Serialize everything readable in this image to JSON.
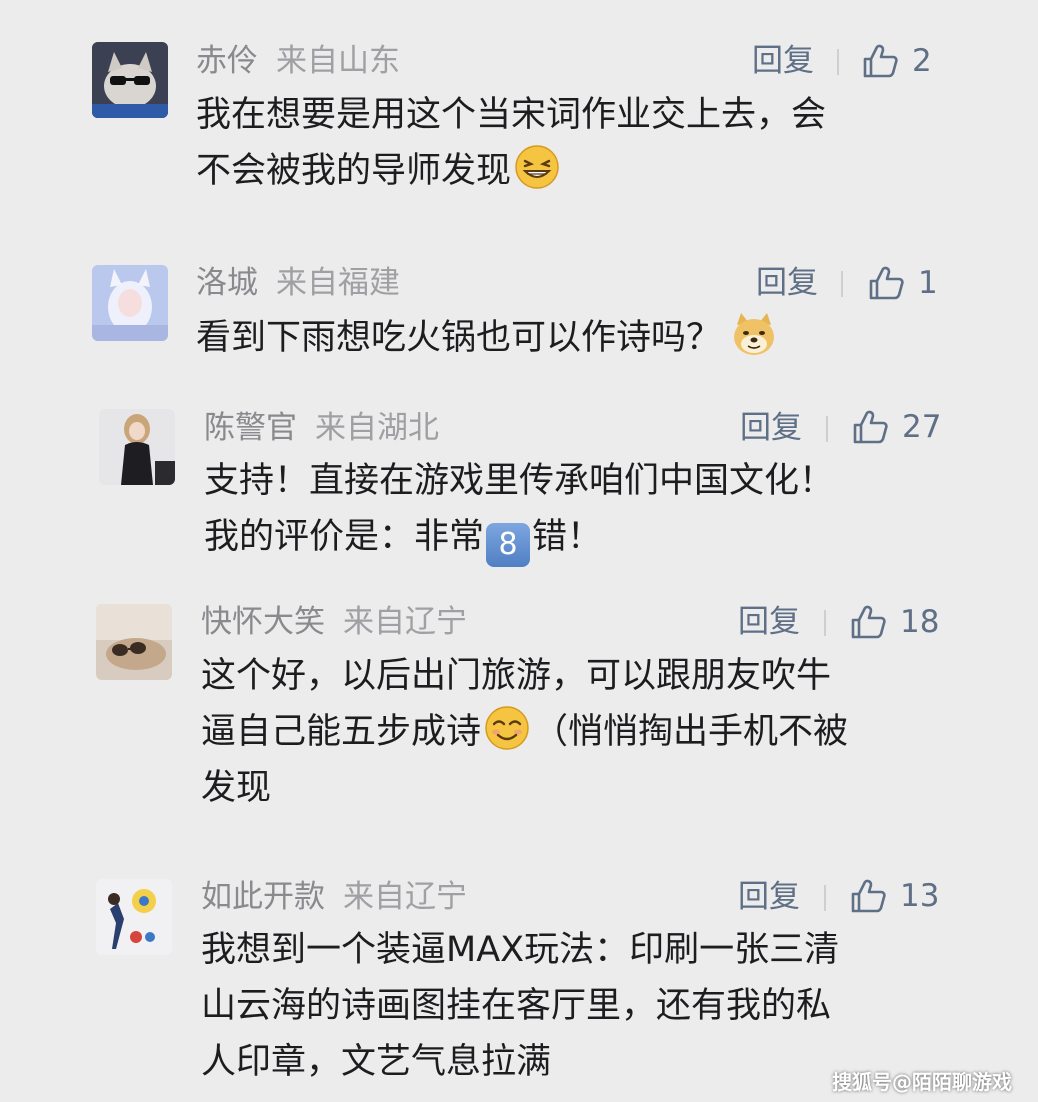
{
  "reply_label": "回复",
  "comments": [
    {
      "username": "赤伶",
      "location": "来自山东",
      "likes": "2",
      "lines": [
        "我在想要是用这个当宋词作业交上去，会",
        "不会被我的导师发现"
      ]
    },
    {
      "username": "洛城",
      "location": "来自福建",
      "likes": "1",
      "lines": [
        "看到下雨想吃火锅也可以作诗吗？"
      ]
    },
    {
      "username": "陈警官",
      "location": "来自湖北",
      "likes": "27",
      "lines": [
        "支持！直接在游戏里传承咱们中国文化！",
        "我的评价是：非常",
        "错！"
      ],
      "badge": "8"
    },
    {
      "username": "快怀大笑",
      "location": "来自辽宁",
      "likes": "18",
      "lines": [
        "这个好，以后出门旅游，可以跟朋友吹牛",
        "逼自己能五步成诗",
        "（悄悄掏出手机不被",
        "发现"
      ]
    },
    {
      "username": "如此开款",
      "location": "来自辽宁",
      "likes": "13",
      "lines": [
        "我想到一个装逼MAX玩法：印刷一张三清",
        "山云海的诗画图挂在客厅里，还有我的私",
        "人印章，文艺气息拉满"
      ]
    }
  ],
  "watermark": "搜狐号@陌陌聊游戏",
  "colors": {
    "background": "#ececed",
    "username": "#8a8a8e",
    "action": "#5f6f86",
    "content": "#1d1d1f"
  },
  "icons": [
    "thumbs-up-icon",
    "grin-emoji",
    "doge-emoji",
    "smirk-emoji",
    "keycap-8-emoji"
  ]
}
